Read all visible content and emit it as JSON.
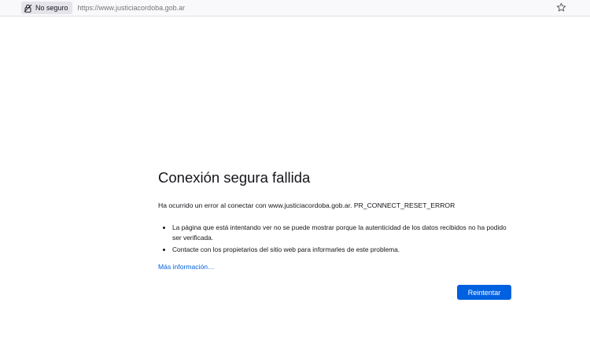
{
  "address_bar": {
    "security_label": "No seguro",
    "url": "https://www.justiciacordoba.gob.ar",
    "lock_icon": "insecure-lock-icon",
    "bookmark_icon": "star-icon"
  },
  "error_page": {
    "title": "Conexión segura fallida",
    "description": "Ha ocurrido un error al conectar con www.justiciacordoba.gob.ar. PR_CONNECT_RESET_ERROR",
    "bullets": [
      "La página que está intentando ver no se puede mostrar porque la autenticidad de los datos recibidos no ha podido ser verificada.",
      "Contacte con los propietarios del sitio web para informarles de este problema."
    ],
    "more_info_link": "Más información…",
    "retry_button": "Reintentar"
  },
  "colors": {
    "accent": "#0061e0",
    "text": "#15141a",
    "url_text": "#76747c"
  }
}
